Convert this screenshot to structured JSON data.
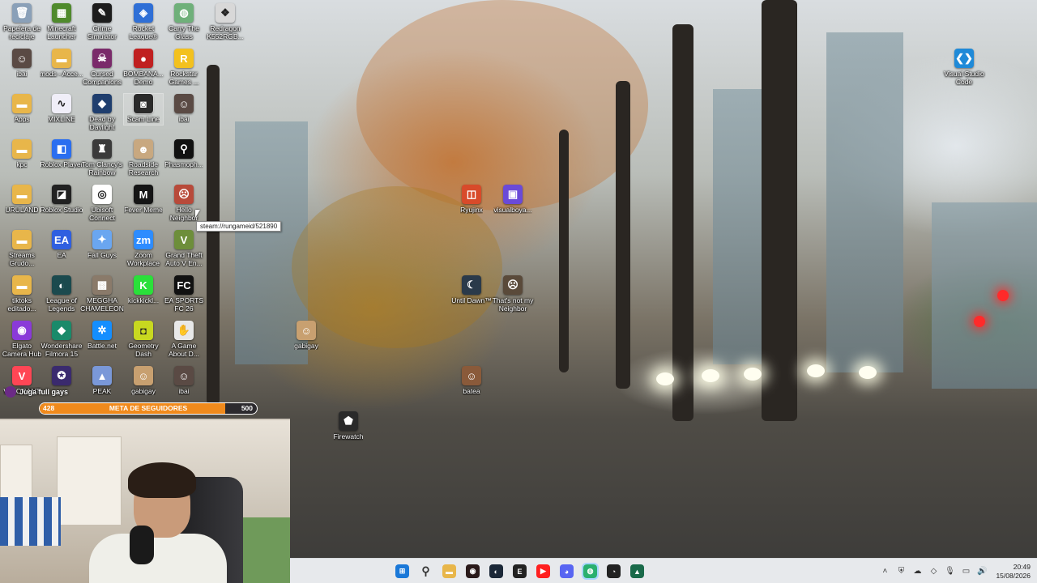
{
  "desktop": {
    "icons": [
      {
        "label": "Papelera de reciclaje",
        "icon": "recycle-bin-icon",
        "color": "#8aa0b8",
        "glyph": "🗑"
      },
      {
        "label": "Minecraft Launcher",
        "icon": "minecraft-icon",
        "color": "#4f8a2c",
        "glyph": "▦"
      },
      {
        "label": "Crime Simulator",
        "icon": "crime-simulator-icon",
        "color": "#1c1c1c",
        "glyph": "✎"
      },
      {
        "label": "Rocket League®",
        "icon": "rocket-league-icon",
        "color": "#2f6fd6",
        "glyph": "◈"
      },
      {
        "label": "Carry The Glass",
        "icon": "carry-the-glass-icon",
        "color": "#6fb07a",
        "glyph": "◍"
      },
      {
        "label": "Redragon K552RGB...",
        "icon": "redragon-icon",
        "color": "#d8d8d8",
        "glyph": "❖"
      },
      {
        "label": "ibai",
        "icon": "user-photo-icon",
        "color": "#5a4a44",
        "glyph": "☺"
      },
      {
        "label": "mods - Acce...",
        "icon": "folder-shortcut-icon",
        "color": "#e8b64a",
        "glyph": "▬"
      },
      {
        "label": "Cursed Companions",
        "icon": "cursed-companions-icon",
        "color": "#7a2a6a",
        "glyph": "☠"
      },
      {
        "label": "BOMBANA... Demo",
        "icon": "bombana-icon",
        "color": "#c02020",
        "glyph": "●"
      },
      {
        "label": "Rockstar Games ...",
        "icon": "rockstar-icon",
        "color": "#f3c11e",
        "glyph": "R"
      },
      {
        "label": "Apps",
        "icon": "folder-icon",
        "color": "#e8b64a",
        "glyph": "▬"
      },
      {
        "label": "MIXLINE",
        "icon": "mixline-icon",
        "color": "#f0eef8",
        "glyph": "∿"
      },
      {
        "label": "Dead by Daylight",
        "icon": "dead-by-daylight-icon",
        "color": "#1f3e6e",
        "glyph": "◆"
      },
      {
        "label": "Scam Line",
        "icon": "scam-line-icon",
        "color": "#2a2a2a",
        "glyph": "◙"
      },
      {
        "label": "ibai",
        "icon": "user-photo-icon",
        "color": "#5a4a44",
        "glyph": "☺"
      },
      {
        "label": "kpc",
        "icon": "folder-icon",
        "color": "#e8b64a",
        "glyph": "▬"
      },
      {
        "label": "Roblox Player",
        "icon": "roblox-player-icon",
        "color": "#2a6ef0",
        "glyph": "◧"
      },
      {
        "label": "Tom Clancy's Rainbow Six...",
        "icon": "rainbow-six-icon",
        "color": "#3a3a3a",
        "glyph": "♜"
      },
      {
        "label": "Roadside Research",
        "icon": "roadside-research-icon",
        "color": "#c8a880",
        "glyph": "☻"
      },
      {
        "label": "Phasmoph...",
        "icon": "phasmophobia-icon",
        "color": "#111111",
        "glyph": "⚲"
      },
      {
        "label": "URULAND",
        "icon": "folder-icon",
        "color": "#e8b64a",
        "glyph": "▬"
      },
      {
        "label": "Roblox Studio",
        "icon": "roblox-studio-icon",
        "color": "#222222",
        "glyph": "◪"
      },
      {
        "label": "Ubisoft Connect",
        "icon": "ubisoft-connect-icon",
        "color": "#ffffff",
        "glyph": "◎"
      },
      {
        "label": "Fever Meme",
        "icon": "fever-meme-icon",
        "color": "#151515",
        "glyph": "M"
      },
      {
        "label": "Hello Neighbor",
        "icon": "hello-neighbor-icon",
        "color": "#b84a3a",
        "glyph": "☹"
      },
      {
        "label": "Streams Grudo...",
        "icon": "folder-shortcut-icon",
        "color": "#e8b64a",
        "glyph": "▬"
      },
      {
        "label": "EA",
        "icon": "ea-icon",
        "color": "#2f5fe0",
        "glyph": "EA"
      },
      {
        "label": "Fall Guys",
        "icon": "fall-guys-icon",
        "color": "#6aa6f0",
        "glyph": "✦"
      },
      {
        "label": "Zoom Workplace",
        "icon": "zoom-icon",
        "color": "#2d8cff",
        "glyph": "zm"
      },
      {
        "label": "Grand Theft Auto V En...",
        "icon": "gta-v-icon",
        "color": "#6d8e3a",
        "glyph": "V"
      },
      {
        "label": "tiktoks editado...",
        "icon": "folder-shortcut-icon",
        "color": "#e8b64a",
        "glyph": "▬"
      },
      {
        "label": "League of Legends",
        "icon": "league-of-legends-icon",
        "color": "#1b4a4e",
        "glyph": "◐"
      },
      {
        "label": "MEGGHA CHAMELEON",
        "icon": "chameleon-icon",
        "color": "#8a7a6a",
        "glyph": "▩"
      },
      {
        "label": "kickkickl...",
        "icon": "kick-icon",
        "color": "#2ae03a",
        "glyph": "K"
      },
      {
        "label": "EA SPORTS FC 26",
        "icon": "ea-sports-fc-icon",
        "color": "#111111",
        "glyph": "FC"
      },
      {
        "label": "Elgato Camera Hub",
        "icon": "elgato-icon",
        "color": "#8a3ad8",
        "glyph": "◉"
      },
      {
        "label": "Wondershare Filmora 15",
        "icon": "filmora-icon",
        "color": "#1a8a6a",
        "glyph": "◆"
      },
      {
        "label": "Battle.net",
        "icon": "battle-net-icon",
        "color": "#148eff",
        "glyph": "✲"
      },
      {
        "label": "Geometry Dash",
        "icon": "geometry-dash-icon",
        "color": "#c8d820",
        "glyph": "◘"
      },
      {
        "label": "A Game About D...",
        "icon": "a-game-about-icon",
        "color": "#e8e8e8",
        "glyph": "✋"
      },
      {
        "label": "VALORANT",
        "icon": "valorant-icon",
        "color": "#ff4655",
        "glyph": "V"
      },
      {
        "label": "",
        "icon": "unknown-app-icon",
        "color": "#3a2a6e",
        "glyph": "✪"
      },
      {
        "label": "PEAK",
        "icon": "peak-icon",
        "color": "#7a98d8",
        "glyph": "▲"
      },
      {
        "label": "gabigay",
        "icon": "user-photo-icon",
        "color": "#c8a070",
        "glyph": "☺"
      },
      {
        "label": "ibai",
        "icon": "user-photo-icon",
        "color": "#5a4a44",
        "glyph": "☺"
      },
      {
        "label": "Ryujinx",
        "icon": "ryujinx-icon",
        "color": "#d84a2a",
        "glyph": "◫"
      },
      {
        "label": "visualboya...",
        "icon": "visualboy-icon",
        "color": "#6a4ad8",
        "glyph": "▣"
      },
      {
        "label": "Until Dawn™",
        "icon": "until-dawn-icon",
        "color": "#2a3a4a",
        "glyph": "☾"
      },
      {
        "label": "That's not my Neighbor",
        "icon": "thats-not-my-neighbor-icon",
        "color": "#5a4a3a",
        "glyph": "☹"
      },
      {
        "label": "gabigay",
        "icon": "user-photo-icon",
        "color": "#c8a070",
        "glyph": "☺"
      },
      {
        "label": "batea",
        "icon": "user-photo-icon",
        "color": "#8a5a3a",
        "glyph": "☺"
      },
      {
        "label": "Firewatch",
        "icon": "firewatch-icon",
        "color": "#2a2a2a",
        "glyph": "⬟"
      },
      {
        "label": "Visual Studio Code",
        "icon": "vscode-icon",
        "color": "#1f8ad8",
        "glyph": "❮❯"
      }
    ],
    "tooltip": "steam://rungameid/521890"
  },
  "stream_overlay": {
    "chat_message": "Juga full gays",
    "goal": {
      "current": "428",
      "title": "META DE SEGUIDORES",
      "target": "500",
      "progress_fraction": 0.856,
      "fill_color": "#f08a1c"
    }
  },
  "taskbar": {
    "apps": [
      {
        "icon": "windows-start-icon",
        "glyph": "⊞",
        "color": "#1a78d8",
        "active": false
      },
      {
        "icon": "search-icon",
        "glyph": "⚲",
        "color": "#333333",
        "active": false
      },
      {
        "icon": "file-explorer-icon",
        "glyph": "▬",
        "color": "#e8b64a",
        "active": false
      },
      {
        "icon": "obs-icon",
        "glyph": "◉",
        "color": "#2a1a1a",
        "active": false
      },
      {
        "icon": "steam-icon",
        "glyph": "◐",
        "color": "#1b2838",
        "active": false
      },
      {
        "icon": "epic-games-icon",
        "glyph": "E",
        "color": "#222222",
        "active": false
      },
      {
        "icon": "youtube-icon",
        "glyph": "▶",
        "color": "#ff2020",
        "active": false
      },
      {
        "icon": "discord-icon",
        "glyph": "◕",
        "color": "#5865f2",
        "active": false
      },
      {
        "icon": "chatterino-icon",
        "glyph": "◍",
        "color": "#2ab070",
        "active": true
      },
      {
        "icon": "github-icon",
        "glyph": "◔",
        "color": "#222222",
        "active": false
      },
      {
        "icon": "streamer-app-icon",
        "glyph": "▲",
        "color": "#1a6a4a",
        "active": false
      }
    ],
    "tray_icons": [
      {
        "icon": "chevron-up-icon",
        "glyph": "˄"
      },
      {
        "icon": "shield-icon",
        "glyph": "⛨"
      },
      {
        "icon": "cloud-icon",
        "glyph": "☁"
      },
      {
        "icon": "app-tray-icon",
        "glyph": "◇"
      },
      {
        "icon": "microphone-icon",
        "glyph": "🎙"
      },
      {
        "icon": "monitor-icon",
        "glyph": "▭"
      },
      {
        "icon": "speaker-icon",
        "glyph": "🔊"
      }
    ],
    "time": "20:49",
    "date": "15/08/2026"
  }
}
